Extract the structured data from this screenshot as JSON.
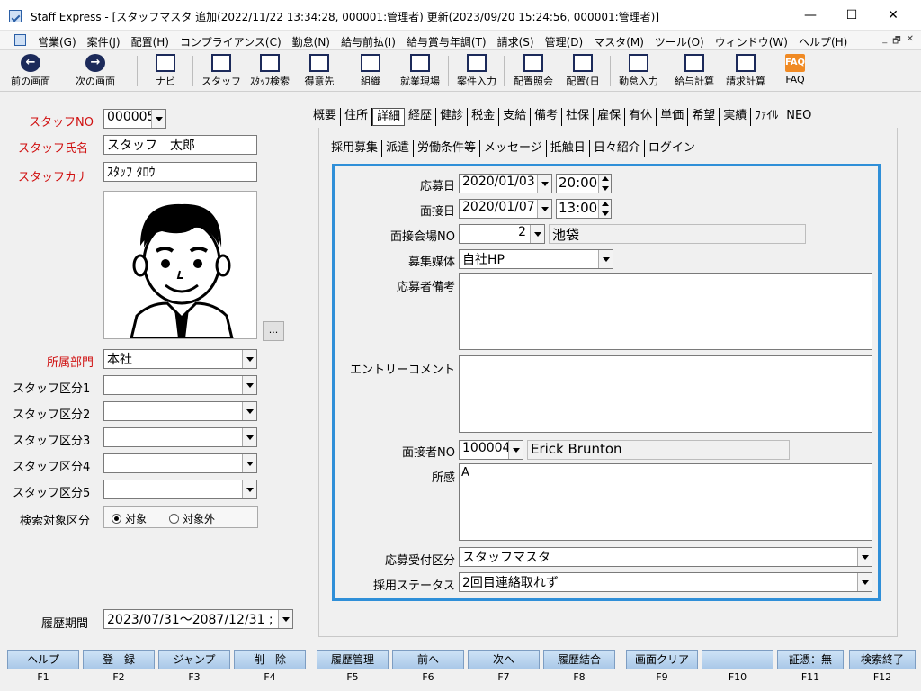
{
  "window": {
    "title": "Staff Express - [スタッフマスタ  追加(2022/11/22 13:34:28, 000001:管理者)  更新(2023/09/20 15:24:56, 000001:管理者)]",
    "minimize": "—",
    "maximize": "☐",
    "close": "✕"
  },
  "menu": {
    "items": [
      "営業(G)",
      "案件(J)",
      "配置(H)",
      "コンプライアンス(C)",
      "勤怠(N)",
      "給与前払(I)",
      "給与賞与年調(T)",
      "請求(S)",
      "管理(D)",
      "マスタ(M)",
      "ツール(O)",
      "ウィンドウ(W)",
      "ヘルプ(H)"
    ],
    "mdi_controls": [
      "_",
      "🗗",
      "✕"
    ]
  },
  "toolbar": {
    "back": "前の画面",
    "forward": "次の画面",
    "navi": "ナビ",
    "staff": "スタッフ",
    "staff_search": "ｽﾀｯﾌ検索",
    "client": "得意先",
    "org": "組織",
    "site": "就業現場",
    "job_entry": "案件入力",
    "placement_ref": "配置照会",
    "placement_day": "配置(日",
    "attendance": "勤怠入力",
    "payroll": "給与計算",
    "billing": "請求計算",
    "faq": "FAQ",
    "faq_icon": "FAQ"
  },
  "left": {
    "staff_no_label": "スタッフNO",
    "staff_no": "000005",
    "staff_name_label": "スタッフ氏名",
    "staff_name": "スタッフ　太郎",
    "staff_kana_label": "スタッフカナ",
    "staff_kana": "ｽﾀｯﾌ ﾀﾛｳ",
    "photo_button": "...",
    "dept_label": "所属部門",
    "dept": "本社",
    "cat1_label": "スタッフ区分1",
    "cat2_label": "スタッフ区分2",
    "cat3_label": "スタッフ区分3",
    "cat4_label": "スタッフ区分4",
    "cat5_label": "スタッフ区分5",
    "search_label": "検索対象区分",
    "radio_on": "対象",
    "radio_off": "対象外",
    "period_label": "履歴期間",
    "period": "2023/07/31～2087/12/31 ;"
  },
  "tabs_top": [
    "概要",
    "住所",
    "詳細",
    "経歴",
    "健診",
    "税金",
    "支給",
    "備考",
    "社保",
    "雇保",
    "有休",
    "単価",
    "希望",
    "実績",
    "ﾌｧｲﾙ",
    "NEO"
  ],
  "tabs_sub": [
    "採用募集",
    "派遣",
    "労働条件等",
    "メッセージ",
    "抵触日",
    "日々紹介",
    "ログイン"
  ],
  "form": {
    "apply_date_label": "応募日",
    "apply_date": "2020/01/03",
    "apply_time": "20:00",
    "interview_date_label": "面接日",
    "interview_date": "2020/01/07",
    "interview_time": "13:00",
    "venue_label": "面接会場NO",
    "venue_no": "2",
    "venue_name": "池袋",
    "media_label": "募集媒体",
    "media": "自社HP",
    "applicant_note_label": "応募者備考",
    "entry_comment_label": "エントリーコメント",
    "interviewer_label": "面接者NO",
    "interviewer_no": "100004",
    "interviewer_name": "Erick Brunton",
    "impression_label": "所感",
    "impression": "A",
    "reception_label": "応募受付区分",
    "reception": "スタッフマスタ",
    "status_label": "採用ステータス",
    "status": "2回目連絡取れず"
  },
  "fkeys": [
    {
      "label": "ヘルプ",
      "key": "F1"
    },
    {
      "label": "登　録",
      "key": "F2"
    },
    {
      "label": "ジャンプ",
      "key": "F3"
    },
    {
      "label": "削　除",
      "key": "F4"
    },
    {
      "label": "履歴管理",
      "key": "F5"
    },
    {
      "label": "前へ",
      "key": "F6"
    },
    {
      "label": "次へ",
      "key": "F7"
    },
    {
      "label": "履歴結合",
      "key": "F8"
    },
    {
      "label": "画面クリア",
      "key": "F9"
    },
    {
      "label": "",
      "key": "F10"
    },
    {
      "label": "証憑：無",
      "key": "F11"
    },
    {
      "label": "検索終了",
      "key": "F12"
    }
  ]
}
